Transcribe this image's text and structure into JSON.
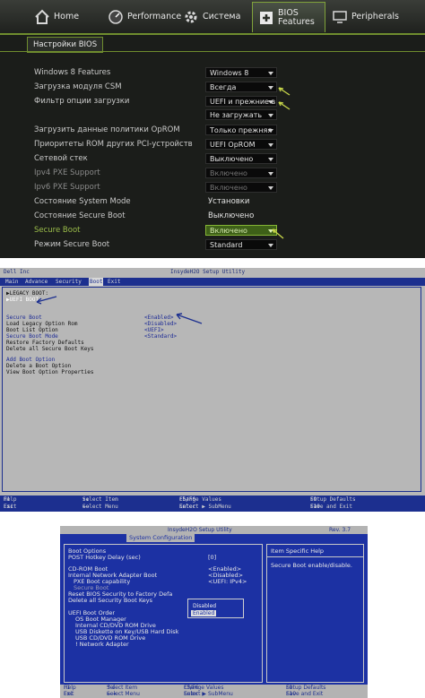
{
  "panel1": {
    "nav": [
      {
        "label": "Home",
        "icon": "home-icon"
      },
      {
        "label": "Performance",
        "icon": "gauge-icon"
      },
      {
        "label": "Система",
        "icon": "gear-icon"
      },
      {
        "label_line1": "BIOS",
        "label_line2": "Features",
        "icon": "bios-chip-icon"
      },
      {
        "label": "Peripherals",
        "icon": "peripherals-icon"
      }
    ],
    "section_tab": "Настройки BIOS",
    "rows": [
      {
        "label": "Windows 8 Features",
        "value": "Windows 8"
      },
      {
        "label": "Загрузка модуля CSM",
        "value": "Всегда"
      },
      {
        "label": "Фильтр опции загрузки",
        "value": "UEFI и прежние в"
      },
      {
        "label": "",
        "value": "Не загружать"
      },
      {
        "label": "Загрузить данные политики OpROM",
        "value": "Только прежняя"
      },
      {
        "label": "Приоритеты ROM других PCI-устройств",
        "value": "UEFI OpROM"
      },
      {
        "label": "Сетевой стек",
        "value": "Выключено"
      },
      {
        "label": "Ipv4 PXE Support",
        "value": "Включено"
      },
      {
        "label": "Ipv6 PXE Support",
        "value": "Включено"
      },
      {
        "label": "Состояние System Mode",
        "value": "Установки"
      },
      {
        "label": "Состояние Secure Boot",
        "value": "Выключено"
      },
      {
        "label": "Secure Boot",
        "value": "Включено"
      },
      {
        "label": "Режим Secure Boot",
        "value": "Standard"
      }
    ],
    "accent": "#86b636"
  },
  "panel2": {
    "title": "InsydeH2O Setup Utility",
    "title_left": "Dell Inc",
    "menu": [
      "Main",
      "Advance",
      "Security",
      "Boot",
      "Exit"
    ],
    "items": [
      {
        "label": "▶LEGACY BOOT:",
        "value": ""
      },
      {
        "label": "▶UEFI BOOT:",
        "value": ""
      },
      {
        "label": "Secure Boot",
        "value": "<Enabled>"
      },
      {
        "label": "Load Legacy Option Rom",
        "value": "<Disabled>"
      },
      {
        "label": "Boot List Option",
        "value": "<UEFI>"
      },
      {
        "label": "Secure Boot Mode",
        "value": "<Standard>"
      },
      {
        "label": "Restore Factory Defaults",
        "value": ""
      },
      {
        "label": "Delete all Secure Boot Keys",
        "value": ""
      },
      {
        "label": "Add Boot Option",
        "value": ""
      },
      {
        "label": "Delete a Boot Option",
        "value": ""
      },
      {
        "label": "View Boot Option Properties",
        "value": ""
      }
    ],
    "footer": [
      {
        "key": "F1",
        "text": "Help"
      },
      {
        "key": "Esc",
        "text": "Exit"
      },
      {
        "key": "↑↓",
        "text": "Select Item"
      },
      {
        "key": "←→",
        "text": "Select Menu"
      },
      {
        "key": "F5/F6",
        "text": "Change Values"
      },
      {
        "key": "Enter",
        "text": "Select ▶ SubMenu"
      },
      {
        "key": "F9",
        "text": "Setup Defaults"
      },
      {
        "key": "F10",
        "text": "Save and Exit"
      }
    ]
  },
  "panel3": {
    "title": "InsydeH2O Setup Utility",
    "rev": "Rev. 3.7",
    "tab": "System Configuration",
    "boot_options_header": "Boot Options",
    "rows": [
      {
        "label": "POST Hotkey Delay (sec)",
        "value": "[0]"
      },
      {
        "label": "CD-ROM Boot",
        "value": "<Enabled>"
      },
      {
        "label": "Internal Network Adapter Boot",
        "value": "<Disabled>"
      },
      {
        "label": "PXE Boot capability",
        "value": "<UEFI: IPv4>"
      },
      {
        "label": "Secure Boot",
        "value": ""
      },
      {
        "label": "Reset BIOS Security to Factory Defa",
        "value": ""
      },
      {
        "label": "Delete all Security Boot Keys",
        "value": ""
      }
    ],
    "popup_options": [
      "Disabled",
      "Enabled"
    ],
    "uefi_header": "UEFI Boot Order",
    "uefi_items": [
      "OS Boot Manager",
      "Internal CD/DVD ROM Drive",
      "USB Diskette on Key/USB Hard Disk",
      "USB CD/DVD ROM Drive",
      "! Network Adapter"
    ],
    "help_title": "Item Specific Help",
    "help_text": "Secure Boot enable/disable.",
    "footer": [
      {
        "key": "F1",
        "text": "Help"
      },
      {
        "key": "Esc",
        "text": "Exit"
      },
      {
        "key": "↑↓",
        "text": "Select Item"
      },
      {
        "key": "←→",
        "text": "Select Menu"
      },
      {
        "key": "F5/F6",
        "text": "Change Values"
      },
      {
        "key": "Enter",
        "text": "Select ▶ SubMenu"
      },
      {
        "key": "F9",
        "text": "Setup Defaults"
      },
      {
        "key": "F10",
        "text": "Save and Exit"
      }
    ]
  }
}
